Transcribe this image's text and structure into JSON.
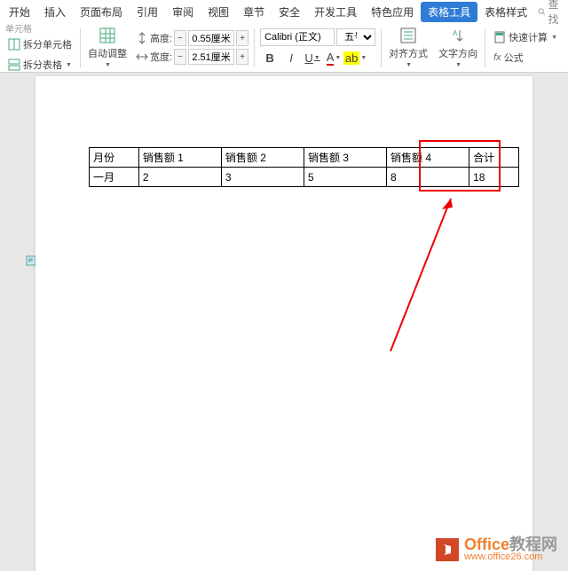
{
  "menu": {
    "items": [
      "开始",
      "插入",
      "页面布局",
      "引用",
      "审阅",
      "视图",
      "章节",
      "安全",
      "开发工具",
      "特色应用",
      "表格工具",
      "表格样式"
    ],
    "active_index": 10,
    "search": "查找"
  },
  "toolbar": {
    "split_cell": "拆分单元格",
    "split_table": "拆分表格",
    "auto_adjust": "自动调整",
    "height_label": "高度:",
    "height_value": "0.55厘米",
    "width_label": "宽度:",
    "width_value": "2.51厘米",
    "font_name": "Calibri (正文)",
    "font_size": "五号",
    "align": "对齐方式",
    "direction": "文字方向",
    "fast_calc": "快速计算",
    "formula": "fx 公式",
    "partial_left": "单元格"
  },
  "table": {
    "headers": [
      "月份",
      "销售额 1",
      "销售额 2",
      "销售额 3",
      "销售额 4",
      "合计"
    ],
    "rows": [
      [
        "一月",
        "2",
        "3",
        "5",
        "8",
        "18"
      ]
    ]
  },
  "watermark": {
    "title1": "Office",
    "title2": "教程网",
    "url": "www.office26.com"
  }
}
